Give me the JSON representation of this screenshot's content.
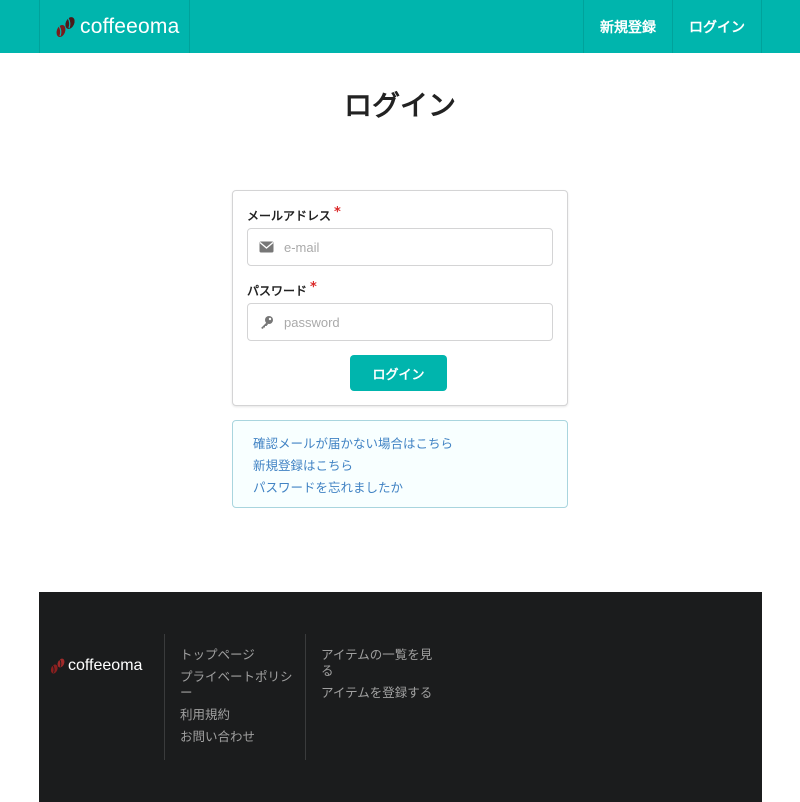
{
  "header": {
    "brand": "coffeeoma",
    "nav": [
      {
        "label": "新規登録"
      },
      {
        "label": "ログイン"
      }
    ]
  },
  "page_title": "ログイン",
  "form": {
    "email": {
      "label": "メールアドレス",
      "required_mark": "*",
      "placeholder": "e-mail",
      "icon": "envelope-icon"
    },
    "password": {
      "label": "パスワード",
      "required_mark": "*",
      "placeholder": "password",
      "icon": "key-icon"
    },
    "submit_label": "ログイン"
  },
  "links": [
    {
      "label": "確認メールが届かない場合はこちら"
    },
    {
      "label": "新規登録はこちら"
    },
    {
      "label": "パスワードを忘れましたか"
    }
  ],
  "footer": {
    "brand": "coffeeoma",
    "column1": [
      {
        "label": "トップページ"
      },
      {
        "label": "プライベートポリシー"
      },
      {
        "label": "利用規約"
      },
      {
        "label": "お問い合わせ"
      }
    ],
    "column2": [
      {
        "label": "アイテムの一覧を見る"
      },
      {
        "label": "アイテムを登録する"
      }
    ]
  },
  "colors": {
    "brand_teal": "#00b5ad",
    "link_blue": "#4183c4",
    "required_red": "#db2828",
    "footer_bg": "#1b1c1d",
    "bean_red": "#8a1f1f"
  }
}
